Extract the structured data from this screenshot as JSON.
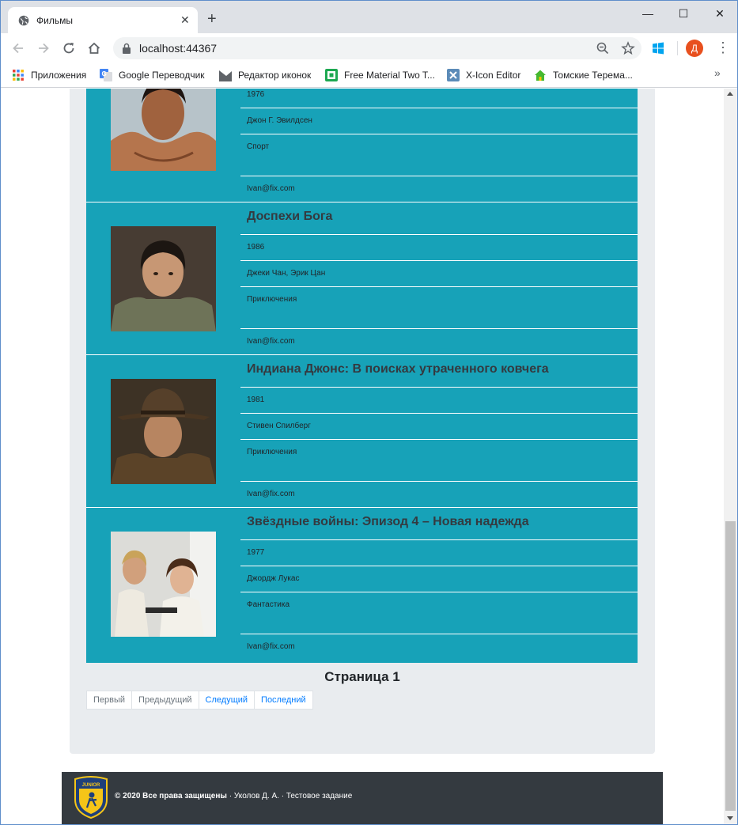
{
  "browser": {
    "tab_title": "Фильмы",
    "tab_close": "✕",
    "new_tab": "+",
    "window_controls": {
      "minimize": "—",
      "maximize": "☐",
      "close": "✕"
    },
    "url": "localhost:44367",
    "profile_initial": "Д",
    "menu": "⋮",
    "bookmarks": [
      {
        "label": "Приложения",
        "icon": "apps-grid-icon"
      },
      {
        "label": "Google Переводчик",
        "icon": "google-translate-icon"
      },
      {
        "label": "Редактор иконок",
        "icon": "icon-editor-icon"
      },
      {
        "label": "Free Material Two T...",
        "icon": "material-icon"
      },
      {
        "label": "X-Icon Editor",
        "icon": "x-icon-editor-icon"
      },
      {
        "label": "Томские Терема...",
        "icon": "house-icon"
      }
    ],
    "bookmarks_more": "»"
  },
  "movies": [
    {
      "title": "",
      "year": "1976",
      "director": "Джон Г. Эвилдсен",
      "genre": "Спорт",
      "email": "Ivan@fix.com"
    },
    {
      "title": "Доспехи Бога",
      "year": "1986",
      "director": "Джеки Чан, Эрик Цан",
      "genre": "Приключения",
      "email": "Ivan@fix.com"
    },
    {
      "title": "Индиана Джонс: В поисках утраченного ковчега",
      "year": "1981",
      "director": "Стивен Спилберг",
      "genre": "Приключения",
      "email": "Ivan@fix.com"
    },
    {
      "title": "Звёздные войны: Эпизод 4 – Новая надежда",
      "year": "1977",
      "director": "Джордж Лукас",
      "genre": "Фантастика",
      "email": "Ivan@fix.com"
    }
  ],
  "pagination": {
    "heading": "Страница 1",
    "first": "Первый",
    "previous": "Предыдущий",
    "next": "Следущий",
    "last": "Последний"
  },
  "footer": {
    "copyright": "© 2020 Все права защищены",
    "separator": " · ",
    "author": "Уколов Д. А.",
    "separator2": " · ",
    "note": "Тестовое задание",
    "logo_text": "JUNIOR"
  },
  "colors": {
    "list_background": "#17a2b8",
    "container_background": "#e9ecef",
    "footer_background": "#343a40",
    "link_color": "#007bff"
  }
}
